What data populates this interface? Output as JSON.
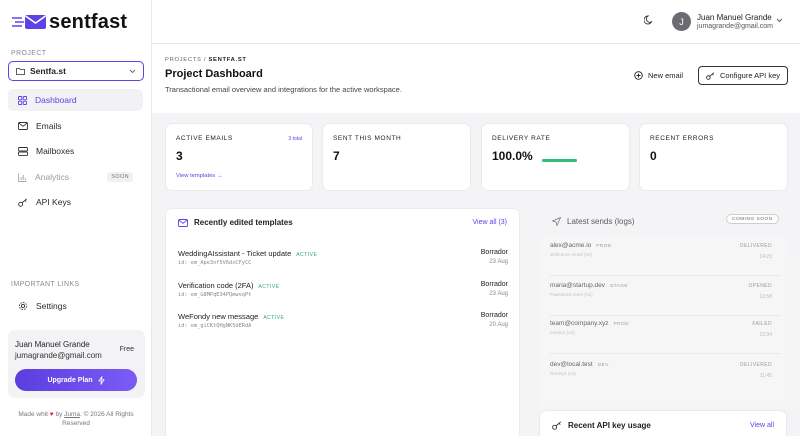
{
  "app": {
    "brand": "sentfast",
    "colors": {
      "accent": "#5b43e6",
      "success": "#2fbf7b",
      "heart": "#e22233"
    }
  },
  "sidebar": {
    "project_label": "PROJECT",
    "project_selected": "Sentfa.st",
    "nav": [
      {
        "label": "Dashboard",
        "icon": "grid-icon",
        "active": true
      },
      {
        "label": "Emails",
        "icon": "mail-icon"
      },
      {
        "label": "Mailboxes",
        "icon": "inbox-icon"
      },
      {
        "label": "Analytics",
        "icon": "chart-icon",
        "badge": "SOON"
      },
      {
        "label": "API Keys",
        "icon": "key-icon"
      }
    ],
    "links_label": "IMPORTANT LINKS",
    "settings_label": "Settings",
    "user": {
      "name": "Juan Manuel Grande",
      "email": "jumagrande@gmail.com",
      "plan": "Free",
      "upgrade_label": "Upgrade Plan"
    },
    "footer": {
      "made_with": "Made whit",
      "by": "by",
      "author": "Juma",
      "rest": ". © 2026 All Rights",
      "line2": "Reserved"
    }
  },
  "topbar": {
    "user_initial": "J",
    "user_name": "Juan Manuel Grande",
    "user_email": "jumagrande@gmail.com"
  },
  "header": {
    "breadcrumb_root": "PROJECTS",
    "breadcrumb_sep": "/",
    "breadcrumb_current": "SENTFA.ST",
    "title": "Project Dashboard",
    "subtitle": "Transactional email overview and integrations for the active workspace.",
    "new_email_label": "New email",
    "configure_label": "Configure API key"
  },
  "stats": [
    {
      "label": "ACTIVE EMAILS",
      "value": "3",
      "badge": "3 total",
      "link": "View templates →"
    },
    {
      "label": "SENT THIS MONTH",
      "value": "7"
    },
    {
      "label": "DELIVERY RATE",
      "value": "100.0%",
      "progress": 1.0
    },
    {
      "label": "RECENT ERRORS",
      "value": "0"
    }
  ],
  "templates": {
    "title": "Recently edited templates",
    "view_all": "View all (3)",
    "items": [
      {
        "name": "WeddingAIssistant - Ticket update",
        "status": "ACTIVE",
        "id": "id: em_Ape3nf5V6dxCFyCC",
        "state": "Borrador",
        "date": "23 Aug"
      },
      {
        "name": "Verification code (2FA)",
        "status": "ACTIVE",
        "id": "id: em_G8MPqE34PQmwvqPt",
        "state": "Borrador",
        "date": "23 Aug"
      },
      {
        "name": "WeFondy new message",
        "status": "ACTIVE",
        "id": "id: em_giCKtQHgNK5dERdA",
        "state": "Borrador",
        "date": "20 Aug"
      }
    ]
  },
  "sends": {
    "title": "Latest sends (logs)",
    "badge": "COMING SOON",
    "items": [
      {
        "email": "alex@acme.io",
        "tag": "PROD",
        "subject": "Welcome email (v2)",
        "status": "DELIVERED",
        "time": "14:23"
      },
      {
        "email": "maria@startup.dev",
        "tag": "STAGE",
        "subject": "Password reset (v1)",
        "status": "OPENED",
        "time": "13:58"
      },
      {
        "email": "team@company.xyz",
        "tag": "PROD",
        "subject": "Invoice (v3)",
        "status": "FAILED",
        "time": "12:34"
      },
      {
        "email": "dev@local.test",
        "tag": "DEV",
        "subject": "Receipt (v1)",
        "status": "DELIVERED",
        "time": "11:45"
      }
    ]
  },
  "api_usage": {
    "title": "Recent API key usage",
    "view_all": "View all"
  }
}
